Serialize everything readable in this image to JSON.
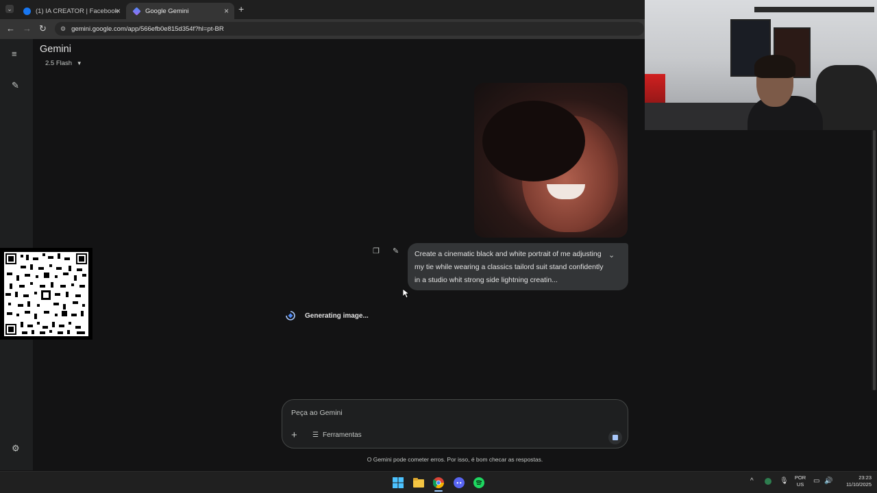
{
  "browser": {
    "tabs": [
      {
        "label": "(1) IA CREATOR | Facebook",
        "icon": "facebook-icon",
        "active": false
      },
      {
        "label": "Google Gemini",
        "icon": "gemini-icon",
        "active": true
      }
    ],
    "address": "gemini.google.com/app/566efb0e815d354f?hl=pt-BR"
  },
  "app": {
    "title": "Gemini",
    "model": "2.5 Flash"
  },
  "chat": {
    "user_prompt": "Create a cinematic black and white portrait of me adjusting my tie while wearing a classics tailord suit stand confidently in a studio whit strong side lightning creatin...",
    "status": "Generating image..."
  },
  "composer": {
    "placeholder": "Peça ao Gemini",
    "tools_label": "Ferramentas",
    "disclaimer": "O Gemini pode cometer erros. Por isso, é bom checar as respostas."
  },
  "taskbar": {
    "apps": [
      "windows-start-icon",
      "file-explorer-icon",
      "chrome-icon",
      "discord-icon",
      "spotify-icon"
    ],
    "lang_top": "POR",
    "lang_bottom": "US",
    "time": "23:23",
    "date": "11/10/2025"
  },
  "colors": {
    "background": "#131314",
    "sidebar": "#1e1f20",
    "bubble": "#333537",
    "accent": "#a8c7fa"
  }
}
